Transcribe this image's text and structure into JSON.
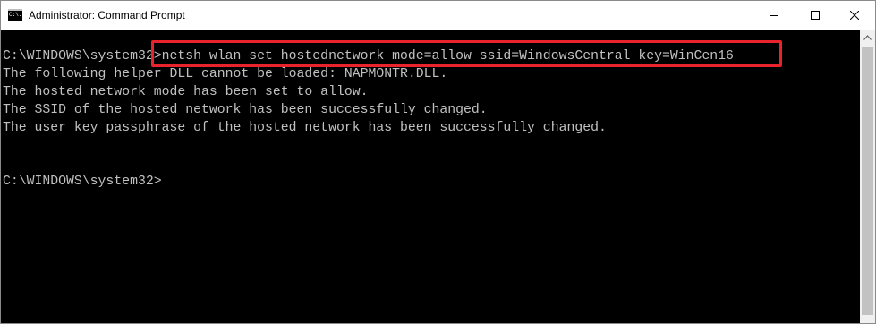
{
  "window": {
    "title": "Administrator: Command Prompt",
    "icon_name": "cmd-icon",
    "icon_text": "C:\\.",
    "buttons": {
      "minimize": "minimize-icon",
      "maximize": "maximize-icon",
      "close": "close-icon"
    }
  },
  "console": {
    "lines": [
      "C:\\WINDOWS\\system32>netsh wlan set hostednetwork mode=allow ssid=WindowsCentral key=WinCen16",
      "The following helper DLL cannot be loaded: NAPMONTR.DLL.",
      "The hosted network mode has been set to allow.",
      "The SSID of the hosted network has been successfully changed.",
      "The user key passphrase of the hosted network has been successfully changed.",
      "",
      "",
      "C:\\WINDOWS\\system32>"
    ],
    "text_color": "#c0c0c0",
    "background": "#000000",
    "highlight_color": "#e8232d"
  },
  "scrollbar": {
    "arrow_icon": "scroll-up-arrow-icon"
  }
}
